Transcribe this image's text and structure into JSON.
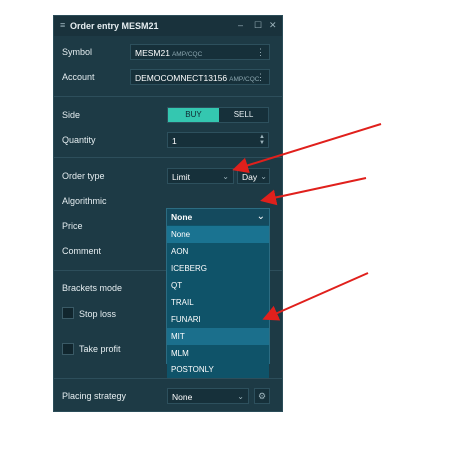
{
  "window": {
    "title": "Order entry MESM21",
    "menu_icon": "hamburger-icon",
    "minimize": "–",
    "maximize": "☐",
    "close": "✕"
  },
  "symbol": {
    "label": "Symbol",
    "value": "MESM21",
    "suffix": "AMP/CQC"
  },
  "account": {
    "label": "Account",
    "value": "DEMOCOMNECT13156",
    "suffix": "AMP/CQC"
  },
  "side": {
    "label": "Side",
    "buy": "BUY",
    "sell": "SELL",
    "selected": "BUY"
  },
  "quantity": {
    "label": "Quantity",
    "value": "1"
  },
  "order_type": {
    "label": "Order type",
    "value": "Limit",
    "tif": "Day"
  },
  "algorithmic": {
    "label": "Algorithmic",
    "value": "None",
    "options": [
      "None",
      "AON",
      "ICEBERG",
      "QT",
      "TRAIL",
      "FUNARI",
      "MIT",
      "MLM",
      "POSTONLY"
    ],
    "highlighted": "MIT"
  },
  "price": {
    "label": "Price"
  },
  "comment": {
    "label": "Comment"
  },
  "brackets": {
    "label": "Brackets mode",
    "stop_loss": "Stop loss",
    "take_profit": "Take profit"
  },
  "placing_strategy": {
    "label": "Placing strategy",
    "value": "None"
  },
  "colors": {
    "panel": "#1d3a45",
    "accent": "#34c7b0",
    "dropdown": "#0f5369",
    "arrow": "#e0201c"
  }
}
